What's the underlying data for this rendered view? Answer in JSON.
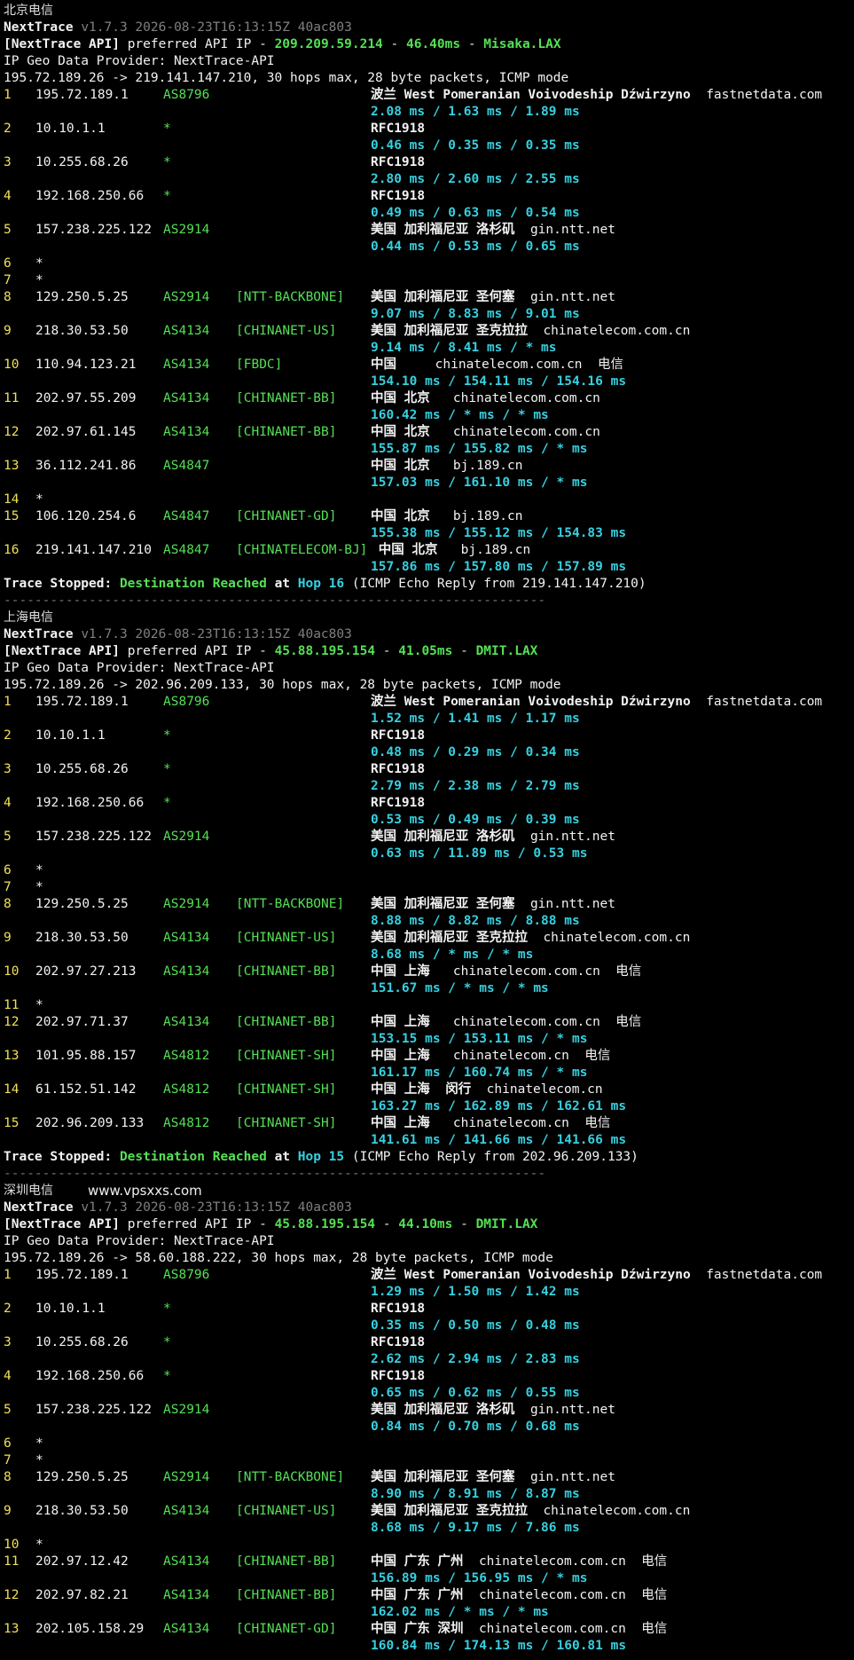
{
  "sections": [
    {
      "title": "北京电信",
      "version": "v1.7.3 2026-08-23T16:13:15Z 40ac803",
      "api_ip": "209.209.59.214",
      "api_latency": "46.40ms",
      "api_node": "Misaka.LAX",
      "route_line": "195.72.189.26 -> 219.141.147.210, 30 hops max, 28 byte packets, ICMP mode",
      "hops": [
        {
          "n": "1",
          "ip": "195.72.189.1",
          "asn": "AS8796",
          "tag": "",
          "geo": "波兰 West Pomeranian Voivodeship Dźwirzyno",
          "dom": "fastnetdata.com",
          "isp": "",
          "lat": "2.08 ms / 1.63 ms / 1.89 ms"
        },
        {
          "n": "2",
          "ip": "10.10.1.1",
          "asn": "*",
          "tag": "",
          "geo": "RFC1918",
          "dom": "",
          "isp": "",
          "lat": "0.46 ms / 0.35 ms / 0.35 ms"
        },
        {
          "n": "3",
          "ip": "10.255.68.26",
          "asn": "*",
          "tag": "",
          "geo": "RFC1918",
          "dom": "",
          "isp": "",
          "lat": "2.80 ms / 2.60 ms / 2.55 ms"
        },
        {
          "n": "4",
          "ip": "192.168.250.66",
          "asn": "*",
          "tag": "",
          "geo": "RFC1918",
          "dom": "",
          "isp": "",
          "lat": "0.49 ms / 0.63 ms / 0.54 ms"
        },
        {
          "n": "5",
          "ip": "157.238.225.122",
          "asn": "AS2914",
          "tag": "",
          "geo": "美国 加利福尼亚 洛杉矶",
          "dom": "gin.ntt.net",
          "isp": "",
          "lat": "0.44 ms / 0.53 ms / 0.65 ms"
        },
        {
          "n": "6",
          "ip": "*",
          "asn": "",
          "tag": "",
          "geo": "",
          "dom": "",
          "isp": "",
          "lat": ""
        },
        {
          "n": "7",
          "ip": "*",
          "asn": "",
          "tag": "",
          "geo": "",
          "dom": "",
          "isp": "",
          "lat": ""
        },
        {
          "n": "8",
          "ip": "129.250.5.25",
          "asn": "AS2914",
          "tag": "[NTT-BACKBONE]",
          "geo": "美国 加利福尼亚 圣何塞",
          "dom": "gin.ntt.net",
          "isp": "",
          "lat": "9.07 ms / 8.83 ms / 9.01 ms"
        },
        {
          "n": "9",
          "ip": "218.30.53.50",
          "asn": "AS4134",
          "tag": "[CHINANET-US]",
          "geo": "美国 加利福尼亚 圣克拉拉",
          "dom": "chinatelecom.com.cn",
          "isp": "",
          "lat": "9.14 ms / 8.41 ms / * ms"
        },
        {
          "n": "10",
          "ip": "110.94.123.21",
          "asn": "AS4134",
          "tag": "[FBDC]",
          "geo": "中国",
          "dom": "   chinatelecom.com.cn",
          "isp": "电信",
          "lat": "154.10 ms / 154.11 ms / 154.16 ms"
        },
        {
          "n": "11",
          "ip": "202.97.55.209",
          "asn": "AS4134",
          "tag": "[CHINANET-BB]",
          "geo": "中国 北京",
          "dom": " chinatelecom.com.cn",
          "isp": "",
          "lat": "160.42 ms / * ms / * ms"
        },
        {
          "n": "12",
          "ip": "202.97.61.145",
          "asn": "AS4134",
          "tag": "[CHINANET-BB]",
          "geo": "中国 北京",
          "dom": " chinatelecom.com.cn",
          "isp": "",
          "lat": "155.87 ms / 155.82 ms / * ms"
        },
        {
          "n": "13",
          "ip": "36.112.241.86",
          "asn": "AS4847",
          "tag": "",
          "geo": "中国 北京",
          "dom": " bj.189.cn",
          "isp": "",
          "lat": "157.03 ms / 161.10 ms / * ms"
        },
        {
          "n": "14",
          "ip": "*",
          "asn": "",
          "tag": "",
          "geo": "",
          "dom": "",
          "isp": "",
          "lat": ""
        },
        {
          "n": "15",
          "ip": "106.120.254.6",
          "asn": "AS4847",
          "tag": "[CHINANET-GD]",
          "geo": "中国 北京",
          "dom": " bj.189.cn",
          "isp": "",
          "lat": "155.38 ms / 155.12 ms / 154.83 ms"
        },
        {
          "n": "16",
          "ip": "219.141.147.210",
          "asn": "AS4847",
          "tag": "[CHINATELECOM-BJ]",
          "geo": " 中国 北京",
          "dom": " bj.189.cn",
          "isp": "",
          "lat": "157.86 ms / 157.80 ms / 157.89 ms"
        }
      ],
      "stopped_hop": "Hop 16",
      "stopped_tail": "(ICMP Echo Reply from 219.141.147.210)"
    },
    {
      "title": "上海电信",
      "version": "v1.7.3 2026-08-23T16:13:15Z 40ac803",
      "api_ip": "45.88.195.154",
      "api_latency": "41.05ms",
      "api_node": "DMIT.LAX",
      "route_line": "195.72.189.26 -> 202.96.209.133, 30 hops max, 28 byte packets, ICMP mode",
      "hops": [
        {
          "n": "1",
          "ip": "195.72.189.1",
          "asn": "AS8796",
          "tag": "",
          "geo": "波兰 West Pomeranian Voivodeship Dźwirzyno",
          "dom": "fastnetdata.com",
          "isp": "",
          "lat": "1.52 ms / 1.41 ms / 1.17 ms"
        },
        {
          "n": "2",
          "ip": "10.10.1.1",
          "asn": "*",
          "tag": "",
          "geo": "RFC1918",
          "dom": "",
          "isp": "",
          "lat": "0.48 ms / 0.29 ms / 0.34 ms"
        },
        {
          "n": "3",
          "ip": "10.255.68.26",
          "asn": "*",
          "tag": "",
          "geo": "RFC1918",
          "dom": "",
          "isp": "",
          "lat": "2.79 ms / 2.38 ms / 2.79 ms"
        },
        {
          "n": "4",
          "ip": "192.168.250.66",
          "asn": "*",
          "tag": "",
          "geo": "RFC1918",
          "dom": "",
          "isp": "",
          "lat": "0.53 ms / 0.49 ms / 0.39 ms"
        },
        {
          "n": "5",
          "ip": "157.238.225.122",
          "asn": "AS2914",
          "tag": "",
          "geo": "美国 加利福尼亚 洛杉矶",
          "dom": "gin.ntt.net",
          "isp": "",
          "lat": "0.63 ms / 11.89 ms / 0.53 ms"
        },
        {
          "n": "6",
          "ip": "*",
          "asn": "",
          "tag": "",
          "geo": "",
          "dom": "",
          "isp": "",
          "lat": ""
        },
        {
          "n": "7",
          "ip": "*",
          "asn": "",
          "tag": "",
          "geo": "",
          "dom": "",
          "isp": "",
          "lat": ""
        },
        {
          "n": "8",
          "ip": "129.250.5.25",
          "asn": "AS2914",
          "tag": "[NTT-BACKBONE]",
          "geo": "美国 加利福尼亚 圣何塞",
          "dom": "gin.ntt.net",
          "isp": "",
          "lat": "8.88 ms / 8.82 ms / 8.88 ms"
        },
        {
          "n": "9",
          "ip": "218.30.53.50",
          "asn": "AS4134",
          "tag": "[CHINANET-US]",
          "geo": "美国 加利福尼亚 圣克拉拉",
          "dom": "chinatelecom.com.cn",
          "isp": "",
          "lat": "8.68 ms / * ms / * ms"
        },
        {
          "n": "10",
          "ip": "202.97.27.213",
          "asn": "AS4134",
          "tag": "[CHINANET-BB]",
          "geo": "中国 上海",
          "dom": " chinatelecom.com.cn",
          "isp": "电信",
          "lat": "151.67 ms / * ms / * ms"
        },
        {
          "n": "11",
          "ip": "*",
          "asn": "",
          "tag": "",
          "geo": "",
          "dom": "",
          "isp": "",
          "lat": ""
        },
        {
          "n": "12",
          "ip": "202.97.71.37",
          "asn": "AS4134",
          "tag": "[CHINANET-BB]",
          "geo": "中国 上海",
          "dom": " chinatelecom.com.cn",
          "isp": "电信",
          "lat": "153.15 ms / 153.11 ms / * ms"
        },
        {
          "n": "13",
          "ip": "101.95.88.157",
          "asn": "AS4812",
          "tag": "[CHINANET-SH]",
          "geo": "中国 上海",
          "dom": " chinatelecom.cn",
          "isp": "电信",
          "lat": "161.17 ms / 160.74 ms / * ms"
        },
        {
          "n": "14",
          "ip": "61.152.51.142",
          "asn": "AS4812",
          "tag": "[CHINANET-SH]",
          "geo": "中国 上海  闵行",
          "dom": "chinatelecom.cn",
          "isp": "",
          "lat": "163.27 ms / 162.89 ms / 162.61 ms"
        },
        {
          "n": "15",
          "ip": "202.96.209.133",
          "asn": "AS4812",
          "tag": "[CHINANET-SH]",
          "geo": "中国 上海",
          "dom": " chinatelecom.cn",
          "isp": "电信",
          "lat": "141.61 ms / 141.66 ms / 141.66 ms"
        }
      ],
      "stopped_hop": "Hop 15",
      "stopped_tail": "(ICMP Echo Reply from 202.96.209.133)"
    },
    {
      "title": "深圳电信",
      "watermark": "www.vpsxxs.com",
      "version": "v1.7.3 2026-08-23T16:13:15Z 40ac803",
      "api_ip": "45.88.195.154",
      "api_latency": "44.10ms",
      "api_node": "DMIT.LAX",
      "route_line": "195.72.189.26 -> 58.60.188.222, 30 hops max, 28 byte packets, ICMP mode",
      "hops": [
        {
          "n": "1",
          "ip": "195.72.189.1",
          "asn": "AS8796",
          "tag": "",
          "geo": "波兰 West Pomeranian Voivodeship Dźwirzyno",
          "dom": "fastnetdata.com",
          "isp": "",
          "lat": "1.29 ms / 1.50 ms / 1.42 ms"
        },
        {
          "n": "2",
          "ip": "10.10.1.1",
          "asn": "*",
          "tag": "",
          "geo": "RFC1918",
          "dom": "",
          "isp": "",
          "lat": "0.35 ms / 0.50 ms / 0.48 ms"
        },
        {
          "n": "3",
          "ip": "10.255.68.26",
          "asn": "*",
          "tag": "",
          "geo": "RFC1918",
          "dom": "",
          "isp": "",
          "lat": "2.62 ms / 2.94 ms / 2.83 ms"
        },
        {
          "n": "4",
          "ip": "192.168.250.66",
          "asn": "*",
          "tag": "",
          "geo": "RFC1918",
          "dom": "",
          "isp": "",
          "lat": "0.65 ms / 0.62 ms / 0.55 ms"
        },
        {
          "n": "5",
          "ip": "157.238.225.122",
          "asn": "AS2914",
          "tag": "",
          "geo": "美国 加利福尼亚 洛杉矶",
          "dom": "gin.ntt.net",
          "isp": "",
          "lat": "0.84 ms / 0.70 ms / 0.68 ms"
        },
        {
          "n": "6",
          "ip": "*",
          "asn": "",
          "tag": "",
          "geo": "",
          "dom": "",
          "isp": "",
          "lat": ""
        },
        {
          "n": "7",
          "ip": "*",
          "asn": "",
          "tag": "",
          "geo": "",
          "dom": "",
          "isp": "",
          "lat": ""
        },
        {
          "n": "8",
          "ip": "129.250.5.25",
          "asn": "AS2914",
          "tag": "[NTT-BACKBONE]",
          "geo": "美国 加利福尼亚 圣何塞",
          "dom": "gin.ntt.net",
          "isp": "",
          "lat": "8.90 ms / 8.91 ms / 8.87 ms"
        },
        {
          "n": "9",
          "ip": "218.30.53.50",
          "asn": "AS4134",
          "tag": "[CHINANET-US]",
          "geo": "美国 加利福尼亚 圣克拉拉",
          "dom": "chinatelecom.com.cn",
          "isp": "",
          "lat": "8.68 ms / 9.17 ms / 7.86 ms"
        },
        {
          "n": "10",
          "ip": "*",
          "asn": "",
          "tag": "",
          "geo": "",
          "dom": "",
          "isp": "",
          "lat": ""
        },
        {
          "n": "11",
          "ip": "202.97.12.42",
          "asn": "AS4134",
          "tag": "[CHINANET-BB]",
          "geo": "中国 广东 广州",
          "dom": "chinatelecom.com.cn",
          "isp": "电信",
          "lat": "156.89 ms / 156.95 ms / * ms"
        },
        {
          "n": "12",
          "ip": "202.97.82.21",
          "asn": "AS4134",
          "tag": "[CHINANET-BB]",
          "geo": "中国 广东 广州",
          "dom": "chinatelecom.com.cn",
          "isp": "电信",
          "lat": "162.02 ms / * ms / * ms"
        },
        {
          "n": "13",
          "ip": "202.105.158.29",
          "asn": "AS4134",
          "tag": "[CHINANET-GD]",
          "geo": "中国 广东 深圳",
          "dom": "chinatelecom.com.cn",
          "isp": "电信",
          "lat": "160.84 ms / 174.13 ms / 160.81 ms"
        }
      ]
    }
  ],
  "labels": {
    "app": "NextTrace",
    "api_prefix": "[NextTrace API]",
    "api_mid": "preferred API IP -",
    "geo_provider": "IP Geo Data Provider: NextTrace-API",
    "stopped": "Trace Stopped:",
    "reached": "Destination Reached",
    "at": "at",
    "separator": "----------------------------------------------------------------------"
  }
}
